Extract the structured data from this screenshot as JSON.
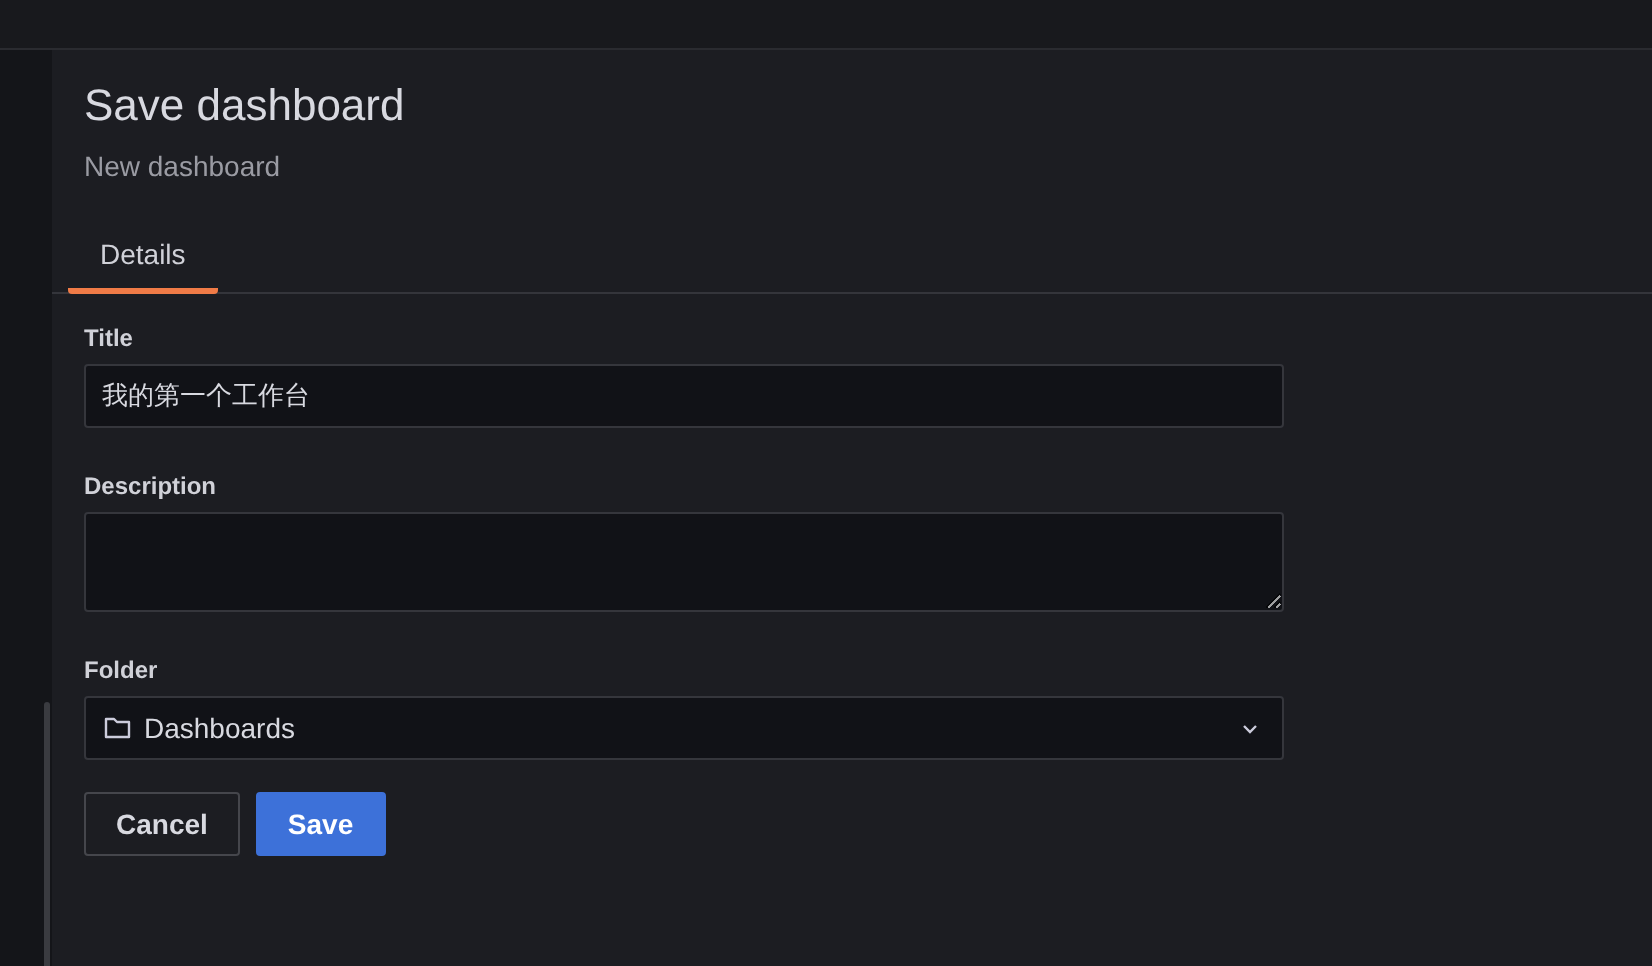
{
  "drawer": {
    "title": "Save dashboard",
    "subtitle": "New dashboard"
  },
  "tabs": [
    {
      "label": "Details",
      "selected": true
    }
  ],
  "form": {
    "title": {
      "label": "Title",
      "value": "我的第一个工作台"
    },
    "description": {
      "label": "Description"
    },
    "folder": {
      "label": "Folder",
      "value": "Dashboards"
    }
  },
  "buttons": [
    {
      "label": "Cancel",
      "kind": "secondary"
    },
    {
      "label": "Save",
      "kind": "primary"
    }
  ]
}
